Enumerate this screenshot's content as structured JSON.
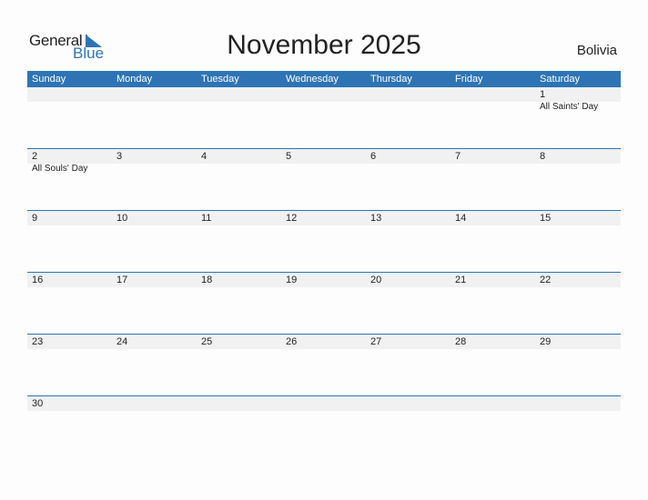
{
  "logo": {
    "word1": "General",
    "word2": "Blue"
  },
  "title": "November 2025",
  "country": "Bolivia",
  "colors": {
    "accent": "#2e74b5",
    "band": "#f1f1f1"
  },
  "weekdays": [
    "Sunday",
    "Monday",
    "Tuesday",
    "Wednesday",
    "Thursday",
    "Friday",
    "Saturday"
  ],
  "weeks": [
    [
      {
        "d": ""
      },
      {
        "d": ""
      },
      {
        "d": ""
      },
      {
        "d": ""
      },
      {
        "d": ""
      },
      {
        "d": ""
      },
      {
        "d": "1",
        "e": "All Saints' Day"
      }
    ],
    [
      {
        "d": "2",
        "e": "All Souls' Day"
      },
      {
        "d": "3"
      },
      {
        "d": "4"
      },
      {
        "d": "5"
      },
      {
        "d": "6"
      },
      {
        "d": "7"
      },
      {
        "d": "8"
      }
    ],
    [
      {
        "d": "9"
      },
      {
        "d": "10"
      },
      {
        "d": "11"
      },
      {
        "d": "12"
      },
      {
        "d": "13"
      },
      {
        "d": "14"
      },
      {
        "d": "15"
      }
    ],
    [
      {
        "d": "16"
      },
      {
        "d": "17"
      },
      {
        "d": "18"
      },
      {
        "d": "19"
      },
      {
        "d": "20"
      },
      {
        "d": "21"
      },
      {
        "d": "22"
      }
    ],
    [
      {
        "d": "23"
      },
      {
        "d": "24"
      },
      {
        "d": "25"
      },
      {
        "d": "26"
      },
      {
        "d": "27"
      },
      {
        "d": "28"
      },
      {
        "d": "29"
      }
    ],
    [
      {
        "d": "30"
      },
      {
        "d": ""
      },
      {
        "d": ""
      },
      {
        "d": ""
      },
      {
        "d": ""
      },
      {
        "d": ""
      },
      {
        "d": ""
      }
    ]
  ]
}
